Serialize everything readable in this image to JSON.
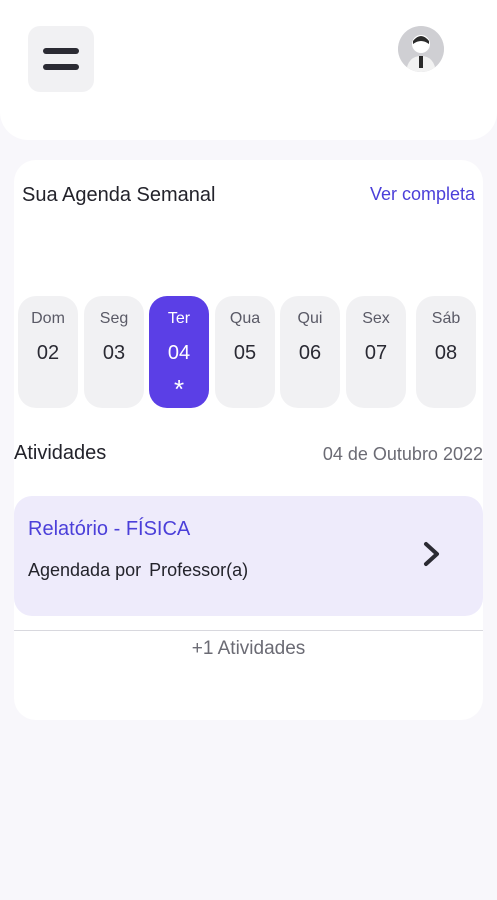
{
  "header": {
    "menu_icon": "hamburger-menu-icon",
    "avatar_icon": "user-avatar"
  },
  "agenda": {
    "title": "Sua Agenda Semanal",
    "link": "Ver completa",
    "days": [
      {
        "name": "Dom",
        "num": "02",
        "active": false
      },
      {
        "name": "Seg",
        "num": "03",
        "active": false
      },
      {
        "name": "Ter",
        "num": "04",
        "active": true,
        "marker": "*"
      },
      {
        "name": "Qua",
        "num": "05",
        "active": false
      },
      {
        "name": "Qui",
        "num": "06",
        "active": false
      },
      {
        "name": "Sex",
        "num": "07",
        "active": false
      },
      {
        "name": "Sáb",
        "num": "08",
        "active": false
      }
    ]
  },
  "activities": {
    "heading": "Atividades",
    "date": "04 de Outubro 2022",
    "items": [
      {
        "title": "Relatório - FÍSICA",
        "label": "Agendada por",
        "value": "Professor(a)"
      }
    ],
    "more": "+1 Atividades"
  },
  "colors": {
    "accent": "#5b3fe6",
    "link": "#4b3fd9",
    "activity_bg": "#eeebfb"
  }
}
